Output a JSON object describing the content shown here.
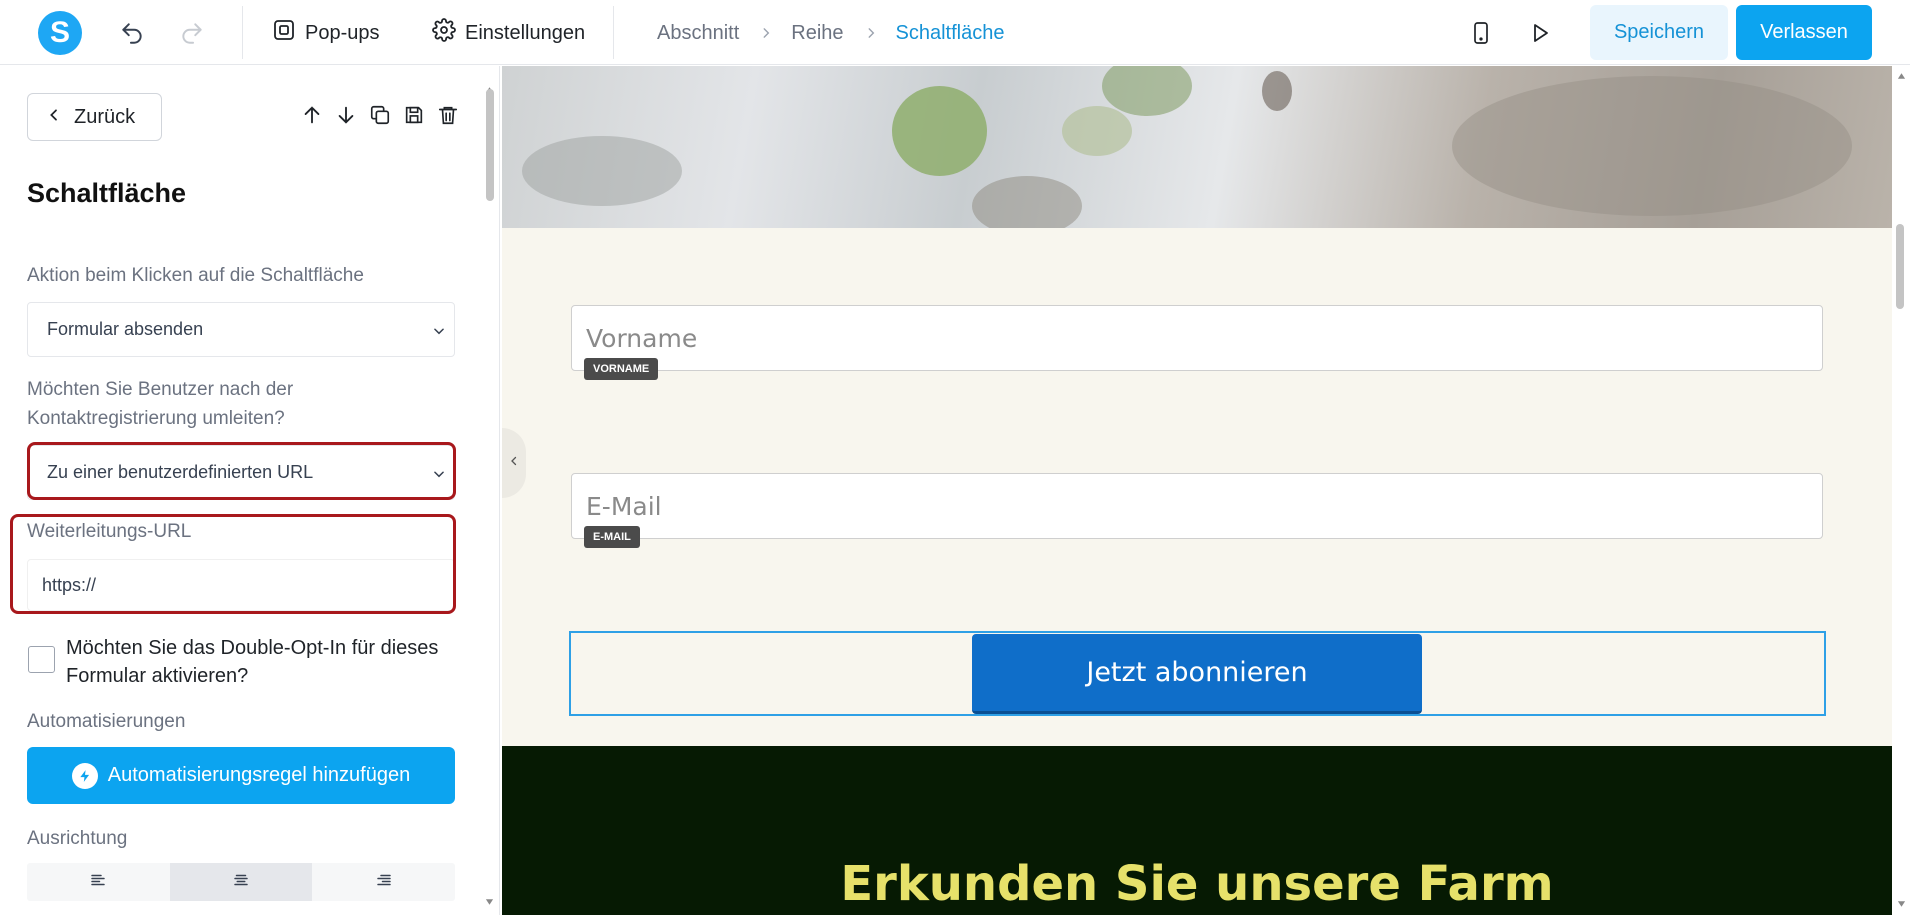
{
  "topbar": {
    "logo_letter": "S",
    "popups_label": "Pop-ups",
    "settings_label": "Einstellungen",
    "breadcrumb": [
      "Abschnitt",
      "Reihe",
      "Schaltfläche"
    ],
    "save_label": "Speichern",
    "leave_label": "Verlassen"
  },
  "sidebar": {
    "back_label": "Zurück",
    "title": "Schaltfläche",
    "click_action_label": "Aktion beim Klicken auf die Schaltfläche",
    "click_action_value": "Formular absenden",
    "redirect_label": "Möchten Sie Benutzer nach der Kontaktregistrierung umleiten?",
    "redirect_value": "Zu einer benutzerdefinierten URL",
    "redirect_url_label": "Weiterleitungs-URL",
    "redirect_url_value": "https://",
    "double_opt_in_label": "Möchten Sie das Double-Opt-In für dieses Formular aktivieren?",
    "automations_label": "Automatisierungen",
    "add_automation_label": "Automatisierungsregel hinzufügen",
    "alignment_label": "Ausrichtung"
  },
  "canvas": {
    "first_name_placeholder": "Vorname",
    "first_name_tag": "VORNAME",
    "email_placeholder": "E-Mail",
    "email_tag": "E-MAIL",
    "subscribe_label": "Jetzt abonnieren",
    "section_title": "Erkunden Sie unsere Farm"
  },
  "colors": {
    "brand": "#0ca4f0",
    "highlight": "#a8181c",
    "subscribe_button": "#0f6ec9",
    "dark_section": "#061a03",
    "section_title": "#e6e16a"
  }
}
